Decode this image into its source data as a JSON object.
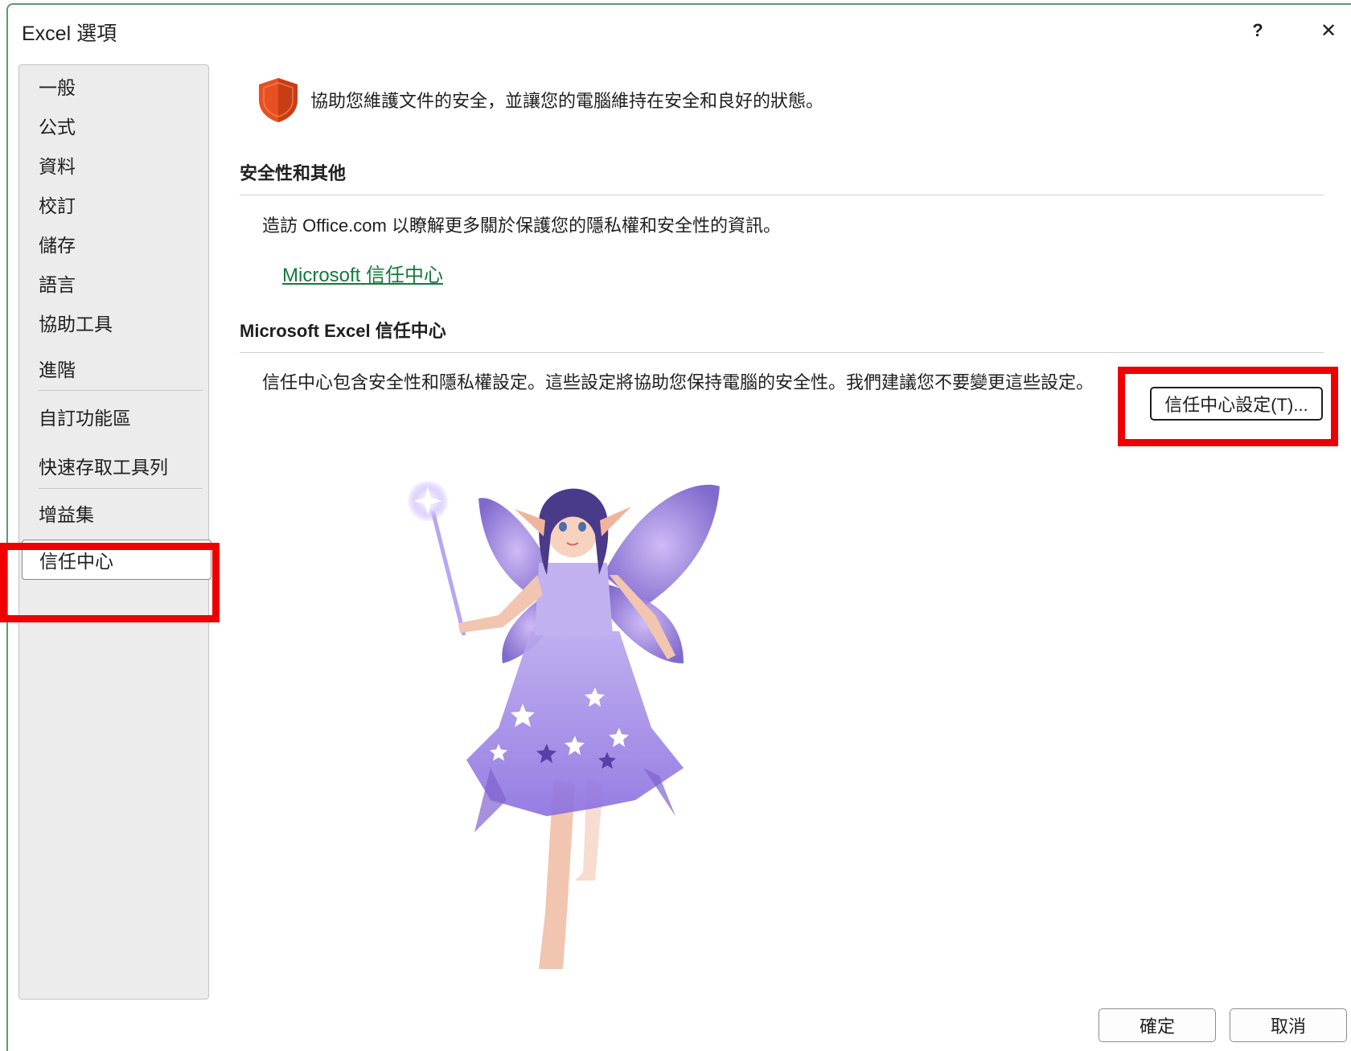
{
  "window": {
    "title": "Excel 選項",
    "help_glyph": "?",
    "close_glyph": "✕"
  },
  "sidebar": {
    "items": [
      {
        "label": "一般"
      },
      {
        "label": "公式"
      },
      {
        "label": "資料"
      },
      {
        "label": "校訂"
      },
      {
        "label": "儲存"
      },
      {
        "label": "語言"
      },
      {
        "label": "協助工具"
      },
      {
        "label": "進階"
      },
      {
        "label": "自訂功能區"
      },
      {
        "label": "快速存取工具列"
      },
      {
        "label": "增益集"
      },
      {
        "label": "信任中心",
        "selected": true
      }
    ]
  },
  "content": {
    "intro": "協助您維護文件的安全，並讓您的電腦維持在安全和良好的狀態。",
    "section1": {
      "title": "安全性和其他",
      "text": "造訪 Office.com 以瞭解更多關於保護您的隱私權和安全性的資訊。",
      "link": "Microsoft 信任中心"
    },
    "section2": {
      "title": "Microsoft Excel 信任中心",
      "text": "信任中心包含安全性和隱私權設定。這些設定將協助您保持電腦的安全性。我們建議您不要變更這些設定。",
      "button": "信任中心設定(T)..."
    }
  },
  "footer": {
    "ok": "確定",
    "cancel": "取消"
  },
  "colors": {
    "highlight": "#ee0000",
    "link": "#147a3c",
    "shield": "#e8501f"
  }
}
